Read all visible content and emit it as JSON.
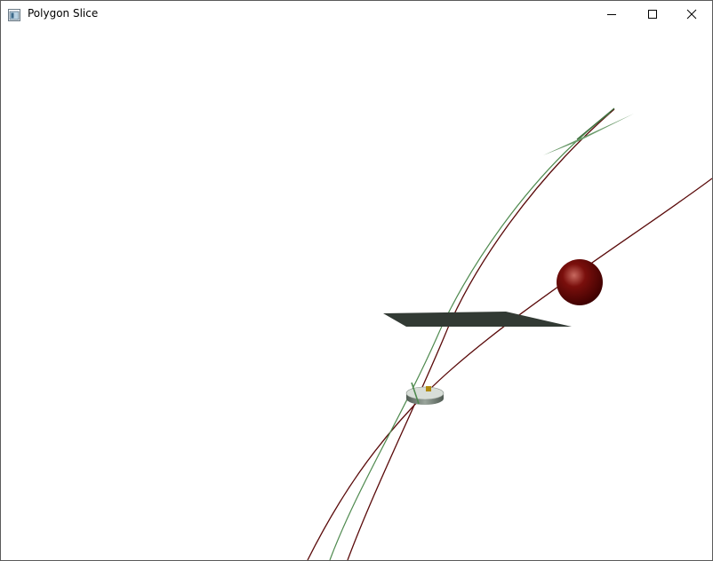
{
  "window": {
    "title": "Polygon Slice",
    "icon": "app-window-icon",
    "controls": {
      "minimize_icon": "minimize-icon",
      "maximize_icon": "maximize-icon",
      "close_icon": "close-icon"
    }
  },
  "scene": {
    "background": "#ffffff",
    "colors": {
      "red_curve": "#5a0a0a",
      "green_curve": "#4f8a4f",
      "plane": "#323a34",
      "sphere_highlight": "#c86a60",
      "sphere_mid": "#7a0f0c",
      "sphere_dark": "#3a0000",
      "disc_top": "#d8ded8",
      "disc_side": "#6f7a72",
      "disc_accent": "#b08a10"
    },
    "objects": [
      "red-curve-long",
      "red-curve-steep",
      "green-curve",
      "dark-plane",
      "red-sphere",
      "cylinder-disc",
      "green-leaf-marker"
    ]
  }
}
